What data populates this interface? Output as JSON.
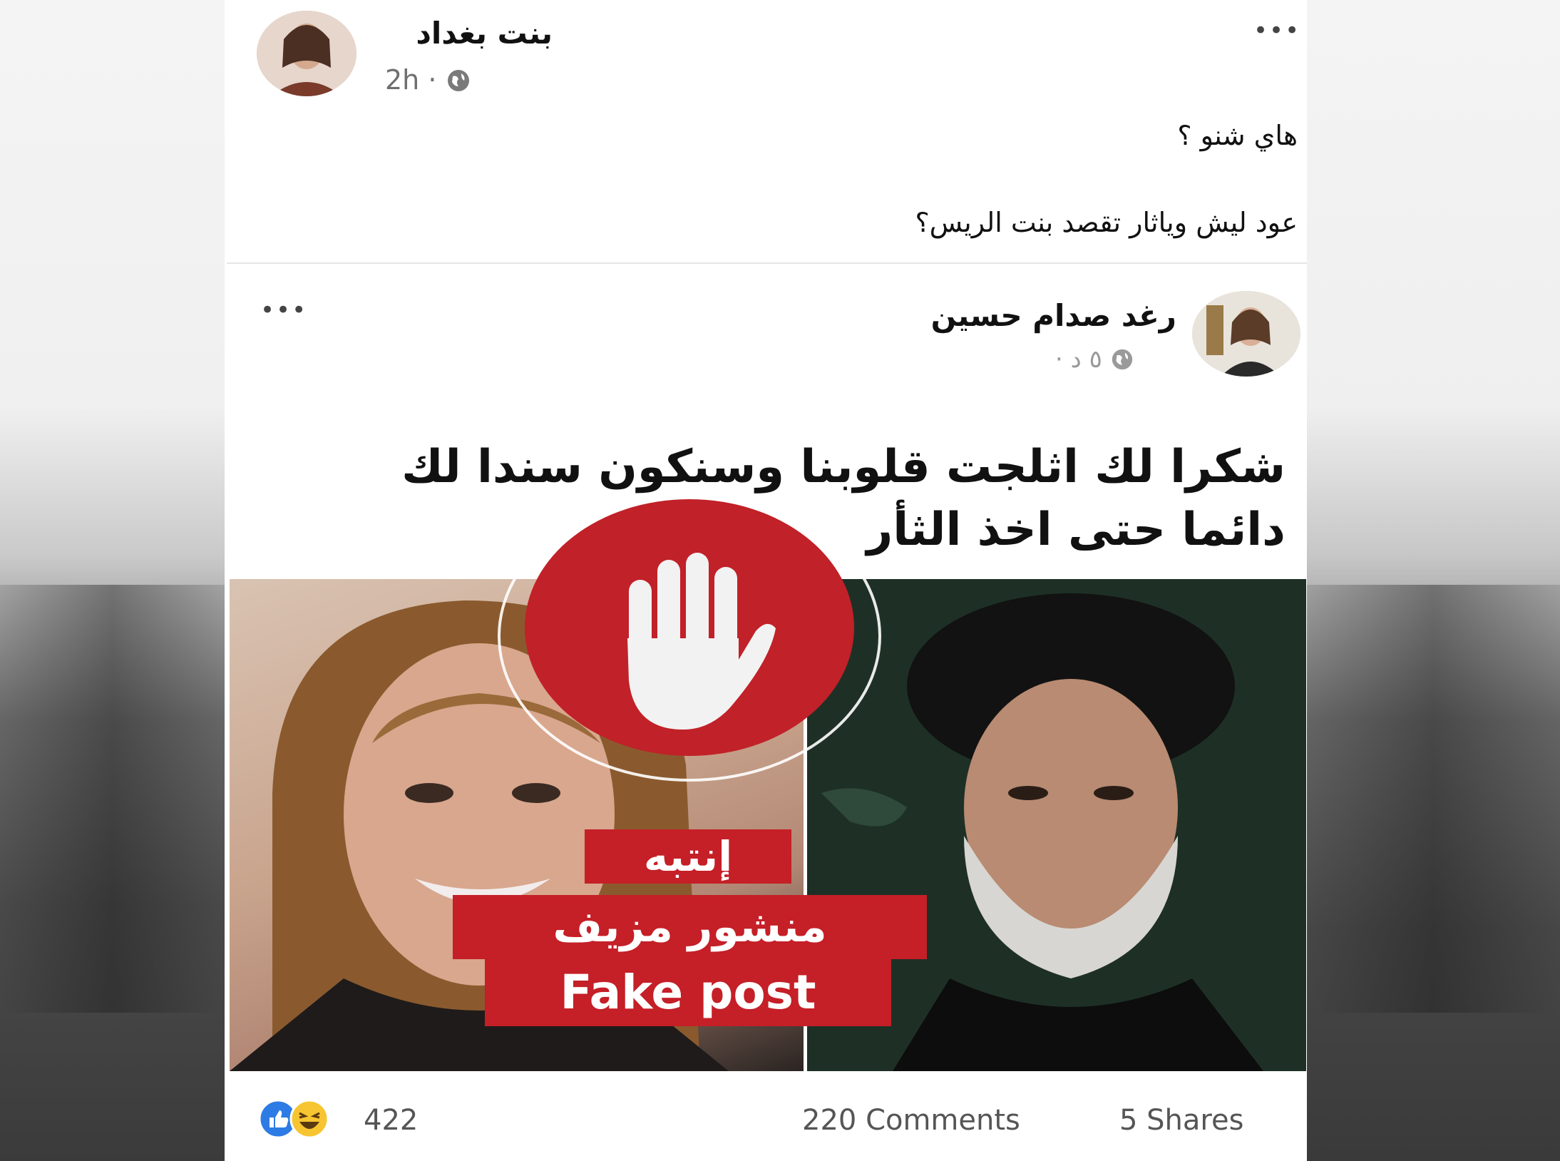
{
  "outer_post": {
    "author": "بنت بغداد",
    "time": "2h ·",
    "more_label": "•••",
    "lines": [
      "هاي شنو ؟",
      "عود ليش وياثار تقصد بنت الريس؟"
    ]
  },
  "shared_post": {
    "author": "رغد صدام حسين",
    "time": "٥ د ·",
    "more_label": "•••",
    "headline": [
      "شكرا لك اثلجت قلوبنا وسنكون سندا لك",
      "دائما حتى اخذ الثأر"
    ]
  },
  "overlay": {
    "line1": "إنتبه",
    "line2": "منشور مزيف",
    "line3": "Fake post",
    "accent": "#c51f27"
  },
  "footer": {
    "reactions_count": "422",
    "comments": "220 Comments",
    "shares": "5 Shares"
  },
  "icons": [
    "globe-icon",
    "like-icon",
    "haha-icon",
    "stop-hand-icon",
    "more-options-icon"
  ]
}
